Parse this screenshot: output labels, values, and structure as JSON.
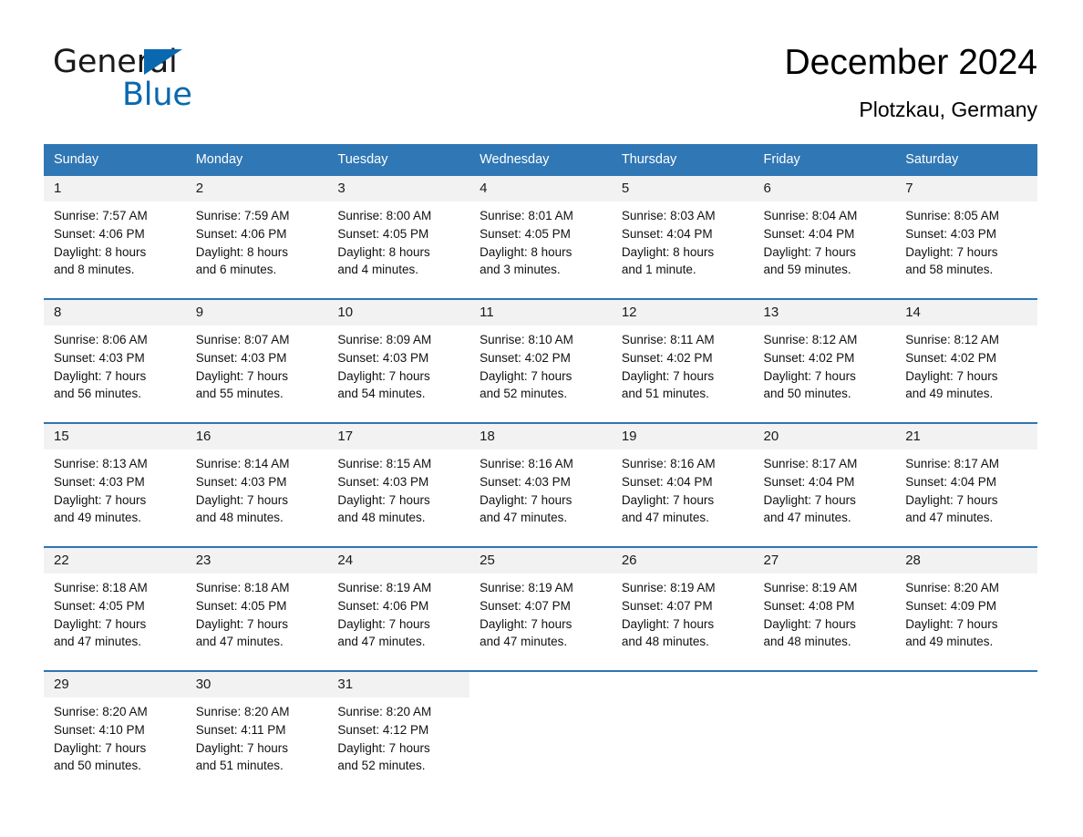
{
  "brand": {
    "name_part1": "General",
    "name_part2": "Blue",
    "triangle_color": "#0a68b0",
    "icon": "triangle-logo-icon"
  },
  "header": {
    "month_title": "December 2024",
    "location": "Plotzkau, Germany"
  },
  "theme": {
    "header_blue": "#3077b5",
    "row_divider_blue": "#2f76b4",
    "daynum_band_gray": "#f2f2f2",
    "text_black": "#111111",
    "brand_blue": "#0a68b0"
  },
  "calendar": {
    "weekday_headers": [
      "Sunday",
      "Monday",
      "Tuesday",
      "Wednesday",
      "Thursday",
      "Friday",
      "Saturday"
    ],
    "weeks": [
      [
        {
          "day": "1",
          "sunrise": "Sunrise: 7:57 AM",
          "sunset": "Sunset: 4:06 PM",
          "daylight1": "Daylight: 8 hours",
          "daylight2": "and 8 minutes."
        },
        {
          "day": "2",
          "sunrise": "Sunrise: 7:59 AM",
          "sunset": "Sunset: 4:06 PM",
          "daylight1": "Daylight: 8 hours",
          "daylight2": "and 6 minutes."
        },
        {
          "day": "3",
          "sunrise": "Sunrise: 8:00 AM",
          "sunset": "Sunset: 4:05 PM",
          "daylight1": "Daylight: 8 hours",
          "daylight2": "and 4 minutes."
        },
        {
          "day": "4",
          "sunrise": "Sunrise: 8:01 AM",
          "sunset": "Sunset: 4:05 PM",
          "daylight1": "Daylight: 8 hours",
          "daylight2": "and 3 minutes."
        },
        {
          "day": "5",
          "sunrise": "Sunrise: 8:03 AM",
          "sunset": "Sunset: 4:04 PM",
          "daylight1": "Daylight: 8 hours",
          "daylight2": "and 1 minute."
        },
        {
          "day": "6",
          "sunrise": "Sunrise: 8:04 AM",
          "sunset": "Sunset: 4:04 PM",
          "daylight1": "Daylight: 7 hours",
          "daylight2": "and 59 minutes."
        },
        {
          "day": "7",
          "sunrise": "Sunrise: 8:05 AM",
          "sunset": "Sunset: 4:03 PM",
          "daylight1": "Daylight: 7 hours",
          "daylight2": "and 58 minutes."
        }
      ],
      [
        {
          "day": "8",
          "sunrise": "Sunrise: 8:06 AM",
          "sunset": "Sunset: 4:03 PM",
          "daylight1": "Daylight: 7 hours",
          "daylight2": "and 56 minutes."
        },
        {
          "day": "9",
          "sunrise": "Sunrise: 8:07 AM",
          "sunset": "Sunset: 4:03 PM",
          "daylight1": "Daylight: 7 hours",
          "daylight2": "and 55 minutes."
        },
        {
          "day": "10",
          "sunrise": "Sunrise: 8:09 AM",
          "sunset": "Sunset: 4:03 PM",
          "daylight1": "Daylight: 7 hours",
          "daylight2": "and 54 minutes."
        },
        {
          "day": "11",
          "sunrise": "Sunrise: 8:10 AM",
          "sunset": "Sunset: 4:02 PM",
          "daylight1": "Daylight: 7 hours",
          "daylight2": "and 52 minutes."
        },
        {
          "day": "12",
          "sunrise": "Sunrise: 8:11 AM",
          "sunset": "Sunset: 4:02 PM",
          "daylight1": "Daylight: 7 hours",
          "daylight2": "and 51 minutes."
        },
        {
          "day": "13",
          "sunrise": "Sunrise: 8:12 AM",
          "sunset": "Sunset: 4:02 PM",
          "daylight1": "Daylight: 7 hours",
          "daylight2": "and 50 minutes."
        },
        {
          "day": "14",
          "sunrise": "Sunrise: 8:12 AM",
          "sunset": "Sunset: 4:02 PM",
          "daylight1": "Daylight: 7 hours",
          "daylight2": "and 49 minutes."
        }
      ],
      [
        {
          "day": "15",
          "sunrise": "Sunrise: 8:13 AM",
          "sunset": "Sunset: 4:03 PM",
          "daylight1": "Daylight: 7 hours",
          "daylight2": "and 49 minutes."
        },
        {
          "day": "16",
          "sunrise": "Sunrise: 8:14 AM",
          "sunset": "Sunset: 4:03 PM",
          "daylight1": "Daylight: 7 hours",
          "daylight2": "and 48 minutes."
        },
        {
          "day": "17",
          "sunrise": "Sunrise: 8:15 AM",
          "sunset": "Sunset: 4:03 PM",
          "daylight1": "Daylight: 7 hours",
          "daylight2": "and 48 minutes."
        },
        {
          "day": "18",
          "sunrise": "Sunrise: 8:16 AM",
          "sunset": "Sunset: 4:03 PM",
          "daylight1": "Daylight: 7 hours",
          "daylight2": "and 47 minutes."
        },
        {
          "day": "19",
          "sunrise": "Sunrise: 8:16 AM",
          "sunset": "Sunset: 4:04 PM",
          "daylight1": "Daylight: 7 hours",
          "daylight2": "and 47 minutes."
        },
        {
          "day": "20",
          "sunrise": "Sunrise: 8:17 AM",
          "sunset": "Sunset: 4:04 PM",
          "daylight1": "Daylight: 7 hours",
          "daylight2": "and 47 minutes."
        },
        {
          "day": "21",
          "sunrise": "Sunrise: 8:17 AM",
          "sunset": "Sunset: 4:04 PM",
          "daylight1": "Daylight: 7 hours",
          "daylight2": "and 47 minutes."
        }
      ],
      [
        {
          "day": "22",
          "sunrise": "Sunrise: 8:18 AM",
          "sunset": "Sunset: 4:05 PM",
          "daylight1": "Daylight: 7 hours",
          "daylight2": "and 47 minutes."
        },
        {
          "day": "23",
          "sunrise": "Sunrise: 8:18 AM",
          "sunset": "Sunset: 4:05 PM",
          "daylight1": "Daylight: 7 hours",
          "daylight2": "and 47 minutes."
        },
        {
          "day": "24",
          "sunrise": "Sunrise: 8:19 AM",
          "sunset": "Sunset: 4:06 PM",
          "daylight1": "Daylight: 7 hours",
          "daylight2": "and 47 minutes."
        },
        {
          "day": "25",
          "sunrise": "Sunrise: 8:19 AM",
          "sunset": "Sunset: 4:07 PM",
          "daylight1": "Daylight: 7 hours",
          "daylight2": "and 47 minutes."
        },
        {
          "day": "26",
          "sunrise": "Sunrise: 8:19 AM",
          "sunset": "Sunset: 4:07 PM",
          "daylight1": "Daylight: 7 hours",
          "daylight2": "and 48 minutes."
        },
        {
          "day": "27",
          "sunrise": "Sunrise: 8:19 AM",
          "sunset": "Sunset: 4:08 PM",
          "daylight1": "Daylight: 7 hours",
          "daylight2": "and 48 minutes."
        },
        {
          "day": "28",
          "sunrise": "Sunrise: 8:20 AM",
          "sunset": "Sunset: 4:09 PM",
          "daylight1": "Daylight: 7 hours",
          "daylight2": "and 49 minutes."
        }
      ],
      [
        {
          "day": "29",
          "sunrise": "Sunrise: 8:20 AM",
          "sunset": "Sunset: 4:10 PM",
          "daylight1": "Daylight: 7 hours",
          "daylight2": "and 50 minutes."
        },
        {
          "day": "30",
          "sunrise": "Sunrise: 8:20 AM",
          "sunset": "Sunset: 4:11 PM",
          "daylight1": "Daylight: 7 hours",
          "daylight2": "and 51 minutes."
        },
        {
          "day": "31",
          "sunrise": "Sunrise: 8:20 AM",
          "sunset": "Sunset: 4:12 PM",
          "daylight1": "Daylight: 7 hours",
          "daylight2": "and 52 minutes."
        },
        {
          "day": "",
          "sunrise": "",
          "sunset": "",
          "daylight1": "",
          "daylight2": ""
        },
        {
          "day": "",
          "sunrise": "",
          "sunset": "",
          "daylight1": "",
          "daylight2": ""
        },
        {
          "day": "",
          "sunrise": "",
          "sunset": "",
          "daylight1": "",
          "daylight2": ""
        },
        {
          "day": "",
          "sunrise": "",
          "sunset": "",
          "daylight1": "",
          "daylight2": ""
        }
      ]
    ]
  }
}
